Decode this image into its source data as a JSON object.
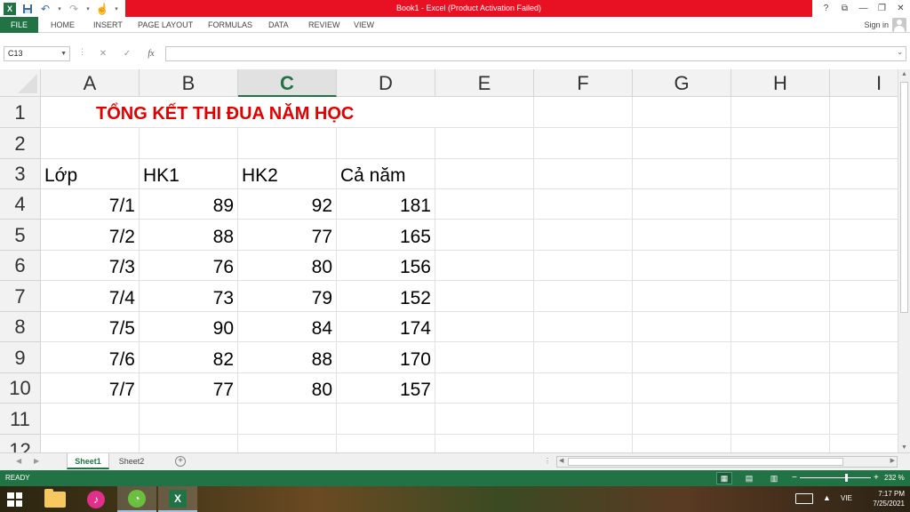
{
  "titlebar": {
    "title": "Book1 -  Excel (Product Activation Failed)",
    "app_logo": "X",
    "help": "?",
    "restore_ribbon": "⧉",
    "minimize": "—",
    "maximize": "❐",
    "close": "✕"
  },
  "ribbon": {
    "tabs": [
      "FILE",
      "HOME",
      "INSERT",
      "PAGE LAYOUT",
      "FORMULAS",
      "DATA",
      "REVIEW",
      "VIEW"
    ],
    "signin": "Sign in"
  },
  "formula_bar": {
    "name_box": "C13",
    "cancel": "✕",
    "enter": "✓",
    "fx": "fx",
    "formula": ""
  },
  "grid": {
    "columns": [
      "A",
      "B",
      "C",
      "D",
      "E",
      "F",
      "G",
      "H",
      "I"
    ],
    "selected_column": "C",
    "rows": [
      "1",
      "2",
      "3",
      "4",
      "5",
      "6",
      "7",
      "8",
      "9",
      "10",
      "11",
      "12"
    ],
    "title": "TỔNG KẾT THI ĐUA NĂM HỌC",
    "header": [
      "Lớp",
      "HK1",
      "HK2",
      "Cả năm"
    ],
    "data": [
      [
        "7/1",
        "89",
        "92",
        "181"
      ],
      [
        "7/2",
        "88",
        "77",
        "165"
      ],
      [
        "7/3",
        "76",
        "80",
        "156"
      ],
      [
        "7/4",
        "73",
        "79",
        "152"
      ],
      [
        "7/5",
        "90",
        "84",
        "174"
      ],
      [
        "7/6",
        "82",
        "88",
        "170"
      ],
      [
        "7/7",
        "77",
        "80",
        "157"
      ]
    ]
  },
  "sheets": {
    "tabs": [
      "Sheet1",
      "Sheet2"
    ],
    "active": "Sheet1",
    "add": "+"
  },
  "status": {
    "ready": "READY",
    "zoom": "232 %",
    "zoom_minus": "−",
    "zoom_plus": "+"
  },
  "taskbar": {
    "language": "VIE",
    "time": "7:17 PM",
    "date": "7/25/2021"
  },
  "colors": {
    "excel_green": "#217346",
    "title_red": "#e00000",
    "titlebar_red": "#e81123"
  }
}
